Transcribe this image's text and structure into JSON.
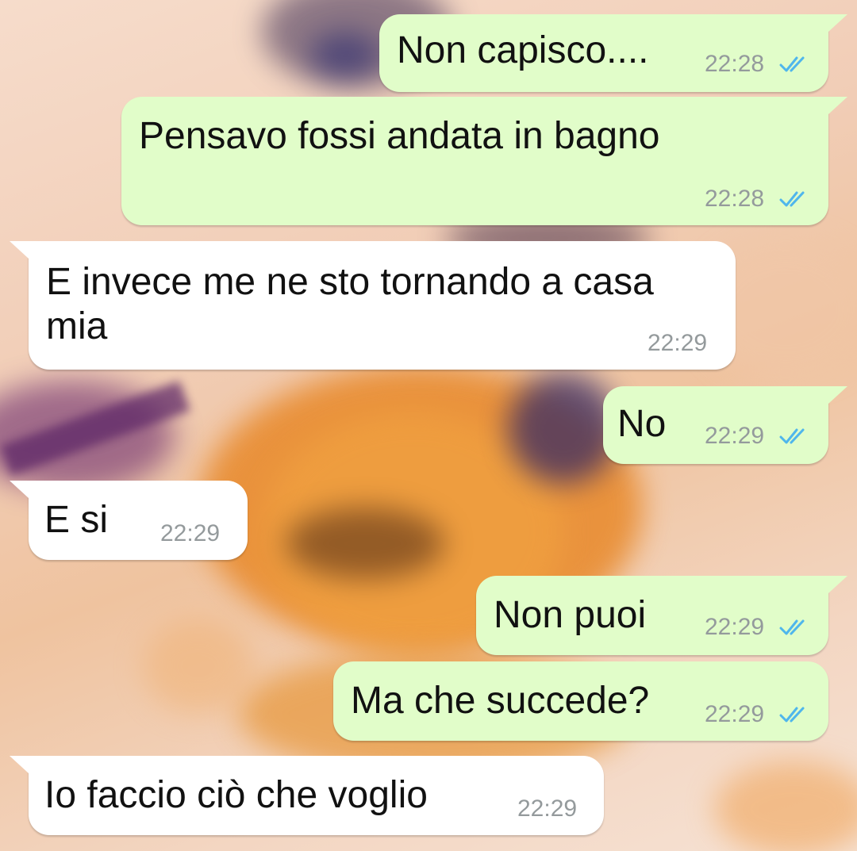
{
  "chat": {
    "messages": [
      {
        "direction": "outgoing",
        "text": "Non capisco....",
        "time": "22:28",
        "status": "read",
        "status_icon": "double-check-icon"
      },
      {
        "direction": "outgoing",
        "text": "Pensavo fossi andata in bagno",
        "time": "22:28",
        "status": "read",
        "status_icon": "double-check-icon"
      },
      {
        "direction": "incoming",
        "text": "E invece me ne sto tornando a casa\nmia",
        "time": "22:29"
      },
      {
        "direction": "outgoing",
        "text": "No",
        "time": "22:29",
        "status": "read",
        "status_icon": "double-check-icon"
      },
      {
        "direction": "incoming",
        "text": "E si",
        "time": "22:29"
      },
      {
        "direction": "outgoing",
        "text": "Non puoi",
        "time": "22:29",
        "status": "read",
        "status_icon": "double-check-icon"
      },
      {
        "direction": "outgoing",
        "text": "Ma che succede?",
        "time": "22:29",
        "status": "read",
        "status_icon": "double-check-icon"
      },
      {
        "direction": "incoming",
        "text": "Io faccio ciò che voglio",
        "time": "22:29"
      }
    ]
  },
  "colors": {
    "outgoing_bubble": "#e1fdc9",
    "incoming_bubble": "#ffffff",
    "read_ticks": "#4fb6ec",
    "timestamp": "#949a9c"
  }
}
